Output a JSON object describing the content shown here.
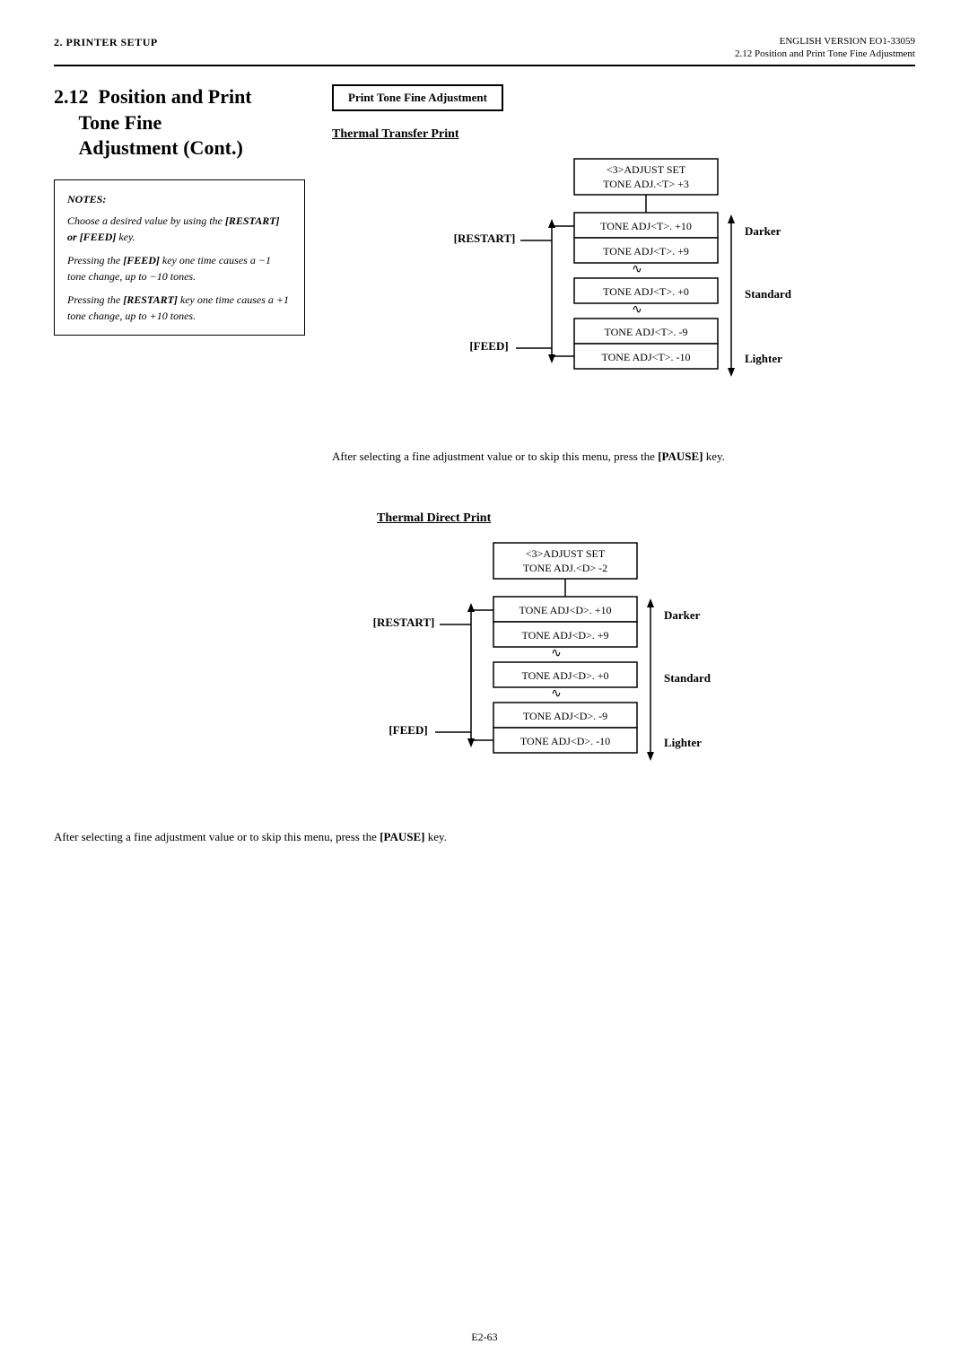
{
  "header": {
    "left": "2.  PRINTER SETUP",
    "right_top": "ENGLISH VERSION EO1-33059",
    "right_bottom": "2.12 Position and Print Tone Fine Adjustment"
  },
  "section": {
    "number": "2.12",
    "title_line1": "Position and Print",
    "title_line2": "Tone Fine",
    "title_line3": "Adjustment (Cont.)"
  },
  "print_tone_label": "Print Tone Fine Adjustment",
  "thermal_transfer": {
    "title": "Thermal Transfer Print",
    "adjust_set": "<3>ADJUST SET",
    "tone_adj_header": "TONE ADJ.<T> +3",
    "rows": [
      "TONE ADJ<T>. +10",
      "TONE ADJ<T>. +9",
      "TONE ADJ<T>. +0",
      "TONE ADJ<T>. -9",
      "TONE ADJ<T>. -10"
    ],
    "restart_label": "[RESTART]",
    "feed_label": "[FEED]",
    "darker_label": "Darker",
    "standard_label": "Standard",
    "lighter_label": "Lighter"
  },
  "thermal_direct": {
    "title": "Thermal Direct Print",
    "adjust_set": "<3>ADJUST SET",
    "tone_adj_header": "TONE ADJ.<D> -2",
    "rows": [
      "TONE ADJ<D>. +10",
      "TONE ADJ<D>. +9",
      "TONE ADJ<D>. +0",
      "TONE ADJ<D>. -9",
      "TONE ADJ<D>. -10"
    ],
    "restart_label": "[RESTART]",
    "feed_label": "[FEED]",
    "darker_label": "Darker",
    "standard_label": "Standard",
    "lighter_label": "Lighter"
  },
  "pause_para_1": "After selecting a fine adjustment value or to skip this menu, press the",
  "pause_key": "[PAUSE]",
  "pause_key_suffix": " key.",
  "pause_para_2": "After selecting a fine adjustment value or to skip this menu, press the",
  "notes": {
    "title": "NOTES:",
    "lines": [
      "Choose a desired value by using the [RESTART] or [FEED] key.",
      "Pressing the [FEED] key one time causes a −1 tone change, up to −10 tones.",
      "Pressing the [RESTART] key one time causes a +1 tone change, up to +10 tones."
    ]
  },
  "footer": {
    "page": "E2-63"
  }
}
